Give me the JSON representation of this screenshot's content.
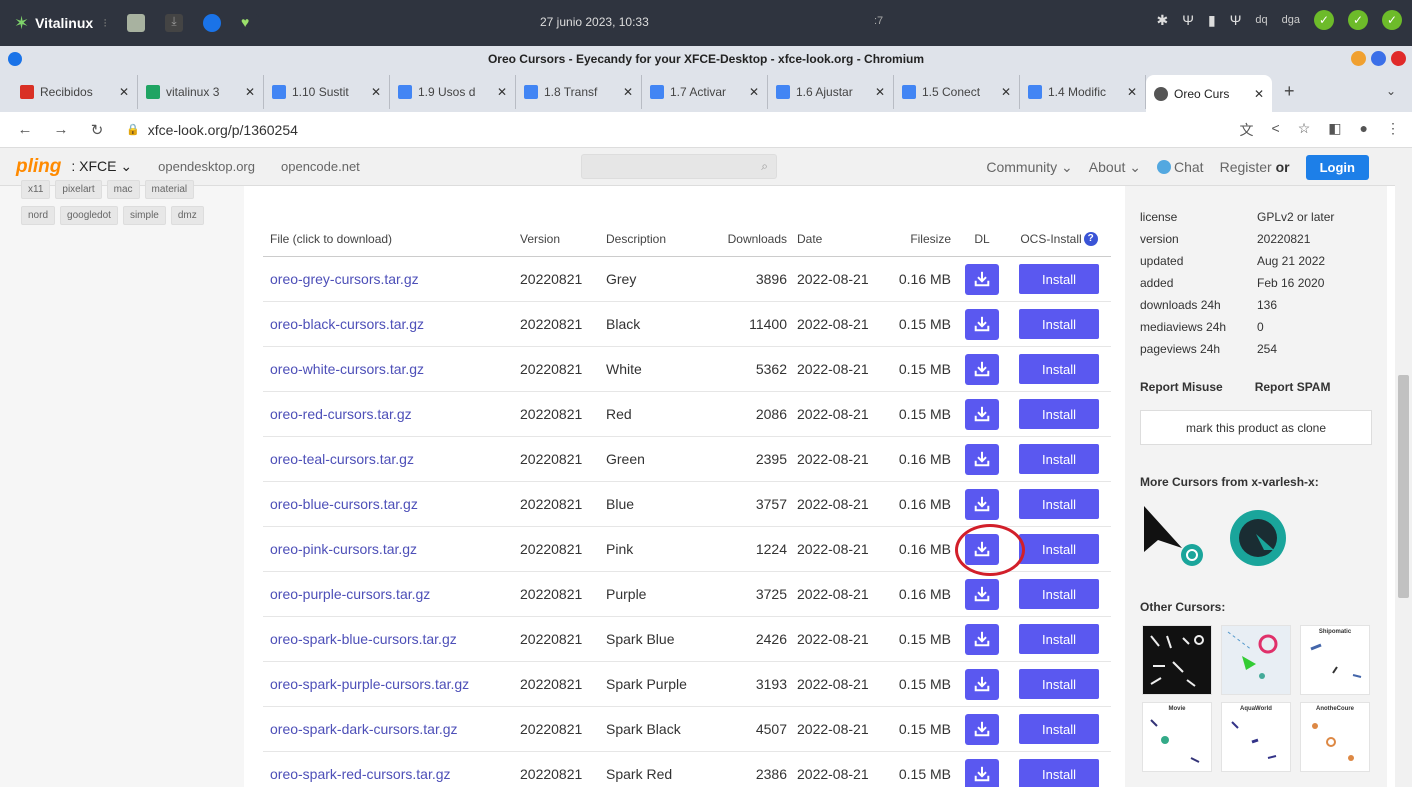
{
  "desktop_panel": {
    "logo_name": "Vitalinux",
    "clock": "27 junio 2023, 10:33",
    "workspace": ":7",
    "user_left": "dq",
    "user_right": "dga"
  },
  "window": {
    "title": "Oreo Cursors - Eyecandy for your XFCE-Desktop - xfce-look.org - Chromium"
  },
  "tabs": [
    {
      "label": "Recibidos",
      "icon": "gmail-icon",
      "color": "#d93025"
    },
    {
      "label": "vitalinux 3",
      "icon": "drive-icon",
      "color": "#1fa463"
    },
    {
      "label": "1.10 Sustit",
      "icon": "docs-icon",
      "color": "#4285f4"
    },
    {
      "label": "1.9 Usos d",
      "icon": "docs-icon",
      "color": "#4285f4"
    },
    {
      "label": "1.8 Transf",
      "icon": "docs-icon",
      "color": "#4285f4"
    },
    {
      "label": "1.7 Activar",
      "icon": "docs-icon",
      "color": "#4285f4"
    },
    {
      "label": "1.6 Ajustar",
      "icon": "docs-icon",
      "color": "#4285f4"
    },
    {
      "label": "1.5 Conect",
      "icon": "docs-icon",
      "color": "#4285f4"
    },
    {
      "label": "1.4 Modific",
      "icon": "docs-icon",
      "color": "#4285f4"
    },
    {
      "label": "Oreo Curs",
      "icon": "site-icon",
      "color": "#555555",
      "active": true
    }
  ],
  "address": {
    "url": "xfce-look.org/p/1360254"
  },
  "site_header": {
    "brand": "pling",
    "store": "XFCE",
    "links": [
      "opendesktop.org",
      "opencode.net"
    ],
    "community": "Community",
    "about": "About",
    "chat": "Chat",
    "register": "Register",
    "or": "or",
    "login": "Login"
  },
  "tags": {
    "row1": [
      "x11",
      "pixelart",
      "mac",
      "material"
    ],
    "row2": [
      "nord",
      "googledot",
      "simple",
      "dmz"
    ]
  },
  "files_table": {
    "headers": {
      "file": "File (click to download)",
      "version": "Version",
      "description": "Description",
      "downloads": "Downloads",
      "date": "Date",
      "filesize": "Filesize",
      "dl": "DL",
      "ocs": "OCS-Install"
    },
    "install_label": "Install",
    "rows": [
      {
        "file": "oreo-grey-cursors.tar.gz",
        "version": "20220821",
        "description": "Grey",
        "downloads": "3896",
        "date": "2022-08-21",
        "size": "0.16 MB"
      },
      {
        "file": "oreo-black-cursors.tar.gz",
        "version": "20220821",
        "description": "Black",
        "downloads": "11400",
        "date": "2022-08-21",
        "size": "0.15 MB"
      },
      {
        "file": "oreo-white-cursors.tar.gz",
        "version": "20220821",
        "description": "White",
        "downloads": "5362",
        "date": "2022-08-21",
        "size": "0.15 MB"
      },
      {
        "file": "oreo-red-cursors.tar.gz",
        "version": "20220821",
        "description": "Red",
        "downloads": "2086",
        "date": "2022-08-21",
        "size": "0.15 MB"
      },
      {
        "file": "oreo-teal-cursors.tar.gz",
        "version": "20220821",
        "description": "Green",
        "downloads": "2395",
        "date": "2022-08-21",
        "size": "0.16 MB"
      },
      {
        "file": "oreo-blue-cursors.tar.gz",
        "version": "20220821",
        "description": "Blue",
        "downloads": "3757",
        "date": "2022-08-21",
        "size": "0.16 MB"
      },
      {
        "file": "oreo-pink-cursors.tar.gz",
        "version": "20220821",
        "description": "Pink",
        "downloads": "1224",
        "date": "2022-08-21",
        "size": "0.16 MB"
      },
      {
        "file": "oreo-purple-cursors.tar.gz",
        "version": "20220821",
        "description": "Purple",
        "downloads": "3725",
        "date": "2022-08-21",
        "size": "0.16 MB"
      },
      {
        "file": "oreo-spark-blue-cursors.tar.gz",
        "version": "20220821",
        "description": "Spark Blue",
        "downloads": "2426",
        "date": "2022-08-21",
        "size": "0.15 MB"
      },
      {
        "file": "oreo-spark-purple-cursors.tar.gz",
        "version": "20220821",
        "description": "Spark Purple",
        "downloads": "3193",
        "date": "2022-08-21",
        "size": "0.15 MB"
      },
      {
        "file": "oreo-spark-dark-cursors.tar.gz",
        "version": "20220821",
        "description": "Spark Black",
        "downloads": "4507",
        "date": "2022-08-21",
        "size": "0.15 MB"
      },
      {
        "file": "oreo-spark-red-cursors.tar.gz",
        "version": "20220821",
        "description": "Spark Red",
        "downloads": "2386",
        "date": "2022-08-21",
        "size": "0.15 MB"
      }
    ]
  },
  "sidebar": {
    "details": [
      {
        "key": "license",
        "value": "GPLv2 or later"
      },
      {
        "key": "version",
        "value": "20220821"
      },
      {
        "key": "updated",
        "value": "Aug 21 2022"
      },
      {
        "key": "added",
        "value": "Feb 16 2020"
      },
      {
        "key": "downloads 24h",
        "value": "136"
      },
      {
        "key": "mediaviews 24h",
        "value": "0"
      },
      {
        "key": "pageviews 24h",
        "value": "254"
      }
    ],
    "report_misuse": "Report Misuse",
    "report_spam": "Report SPAM",
    "clone_button": "mark this product as clone",
    "more_header": "More Cursors from x-varlesh-x:",
    "other_header": "Other Cursors:",
    "thumb_captions": [
      "Shipomatic",
      "Movie",
      "AquaWorld",
      "AnotheCoure"
    ]
  },
  "colors": {
    "accent_button": "#5a58f0",
    "link": "#4d4fb8",
    "login": "#1d7fe8",
    "highlight_circle": "#d21f2a"
  }
}
